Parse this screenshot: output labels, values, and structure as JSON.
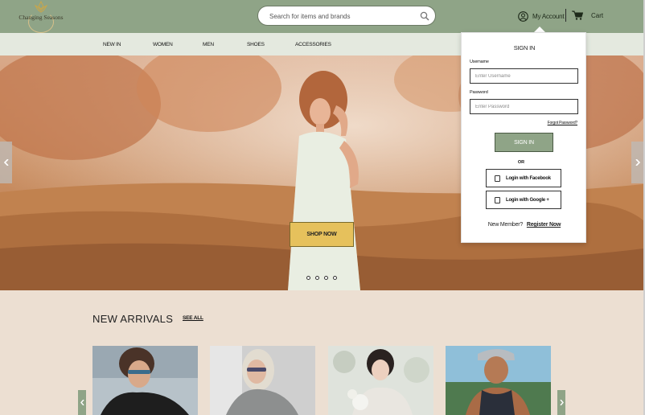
{
  "brand": {
    "name": "Changing Seasons",
    "icon": "lotus-logo-icon"
  },
  "search": {
    "placeholder": "Search for items and brands",
    "icon": "search-icon"
  },
  "header": {
    "account_label": "My Account",
    "cart_label": "Cart"
  },
  "nav": {
    "items": [
      "NEW IN",
      "WOMEN",
      "MEN",
      "SHOES",
      "ACCESSORIES"
    ]
  },
  "hero": {
    "cta_label": "SHOP NOW",
    "slides": 4,
    "active_slide": 1
  },
  "signin": {
    "title": "SIGN IN",
    "username_label": "Username",
    "username_placeholder": "Enter Username",
    "password_label": "Password",
    "password_placeholder": "Enter Password",
    "forgot_label": "Forgot Password?",
    "submit_label": "SIGN IN",
    "or_label": "OR",
    "facebook_label": "Login with Facebook",
    "google_label": "Login with Google +",
    "member_text": "New Member?",
    "register_label": "Register Now"
  },
  "arrivals": {
    "title": "NEW ARRIVALS",
    "see_all_label": "SEE ALL"
  },
  "colors": {
    "header_green": "#8fa487",
    "nav_bg": "#e4e9df",
    "page_bg": "#ecdfd2",
    "cta_yellow": "#e6c15c"
  }
}
